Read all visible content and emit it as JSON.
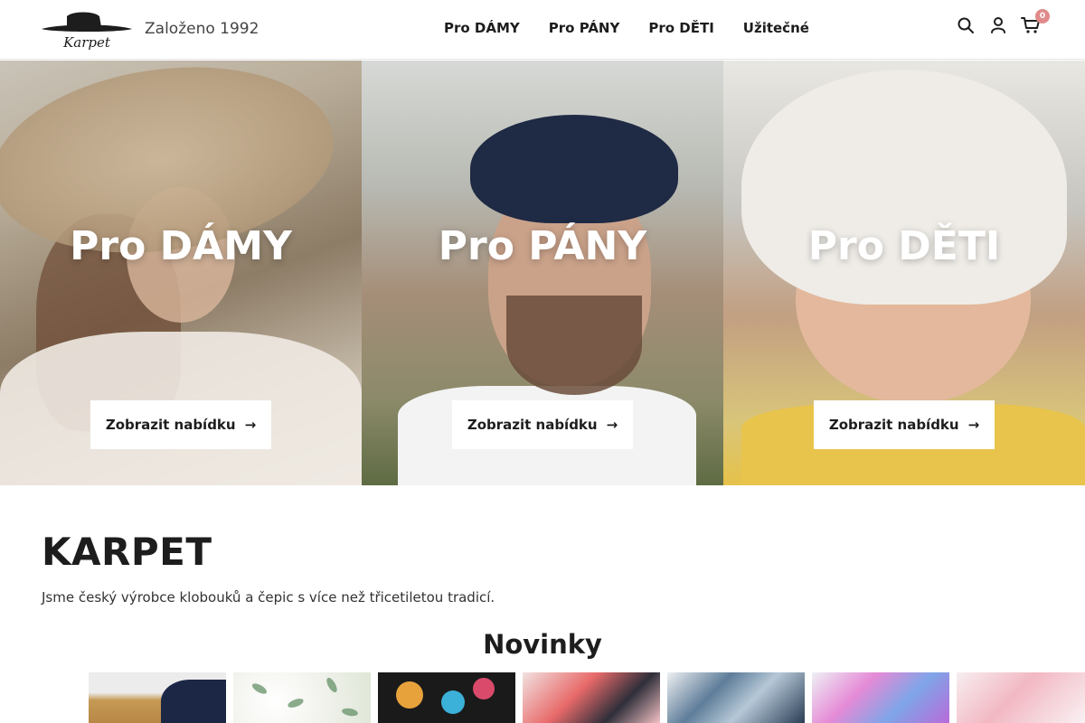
{
  "header": {
    "logo_text": "Karpet",
    "tagline": "Založeno 1992",
    "nav": [
      {
        "label": "Pro DÁMY"
      },
      {
        "label": "Pro PÁNY"
      },
      {
        "label": "Pro DĚTI"
      },
      {
        "label": "Užitečné"
      }
    ],
    "icons": [
      "search-icon",
      "user-icon",
      "cart-icon"
    ],
    "cart_count": "0"
  },
  "hero": {
    "panels": [
      {
        "title": "Pro DÁMY",
        "cta": "Zobrazit nabídku"
      },
      {
        "title": "Pro PÁNY",
        "cta": "Zobrazit nabídku"
      },
      {
        "title": "Pro DĚTI",
        "cta": "Zobrazit nabídku"
      }
    ],
    "cta_icon": "arrow-right-icon"
  },
  "intro": {
    "brand": "KARPET",
    "text": "Jsme český výrobce klobouků a čepic s více než třicetiletou tradicí."
  },
  "news": {
    "title": "Novinky",
    "products_count": 7
  },
  "colors": {
    "accent_badge": "#e08a8a",
    "text": "#1d1d1d",
    "background": "#ffffff"
  }
}
